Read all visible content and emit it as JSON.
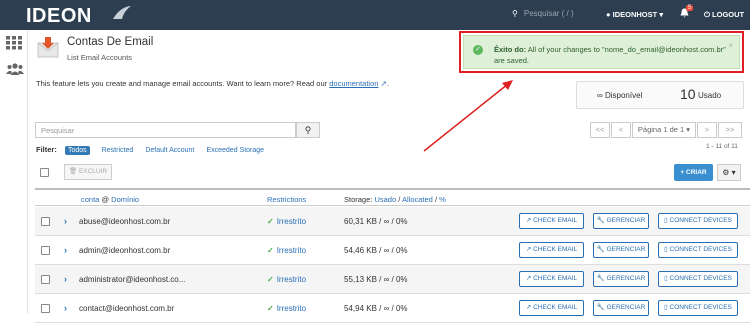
{
  "topbar": {
    "logo": "IDEON",
    "search_placeholder": "Pesquisar ( / )",
    "user": "IDEONHOST",
    "notifications_count": "5",
    "logout": "LOGOUT"
  },
  "page": {
    "title": "Contas De Email",
    "subtitle": "List Email Accounts",
    "intro": "This feature lets you create and manage email accounts. Want to learn more? Read our",
    "doc_link": "documentation",
    "intro_end": "."
  },
  "alert": {
    "strong": "Êxito do:",
    "text": "All of your changes to \"nome_do_email@ideonhost.com.br\" are saved.",
    "close": "×"
  },
  "stats": {
    "available_label": "Disponível",
    "available_symbol": "∞",
    "used_count": "10",
    "used_label": "Usado"
  },
  "search": {
    "placeholder": "Pesquisar"
  },
  "pagination": {
    "first": "<<",
    "prev": "<",
    "page": "Página 1 de 1",
    "next": ">",
    "last": ">>",
    "info": "1 - 11 of 11"
  },
  "filter": {
    "label": "Filter:",
    "options": [
      "Todos",
      "Restricted",
      "Default Account",
      "Exceeded Storage"
    ]
  },
  "toolbar": {
    "delete_label": "EXCLUIR",
    "create_label": "+ CRIAR",
    "gear": "⚙ ▾"
  },
  "table": {
    "headers": {
      "account": "conta",
      "at": "@",
      "domain": "Domínio",
      "restrictions": "Restrictions",
      "storage_prefix": "Storage:",
      "used": "Usado",
      "sep1": "/",
      "allocated": "Allocated",
      "sep2": "/",
      "percent": "%"
    },
    "rows": [
      {
        "email": "abuse@ideonhost.com.br",
        "restriction": "Irrestrito",
        "storage": "60,31 KB / ∞ / 0%"
      },
      {
        "email": "admin@ideonhost.com.br",
        "restriction": "Irrestrito",
        "storage": "54,46 KB / ∞ / 0%"
      },
      {
        "email": "administrator@ideonhost.co...",
        "restriction": "Irrestrito",
        "storage": "55,13 KB / ∞ / 0%"
      },
      {
        "email": "contact@ideonhost.com.br",
        "restriction": "Irrestrito",
        "storage": "54,94 KB / ∞ / 0%"
      }
    ],
    "actions": {
      "check": "CHECK EMAIL",
      "manage": "GERENCIAR",
      "connect": "CONNECT DEVICES"
    }
  }
}
